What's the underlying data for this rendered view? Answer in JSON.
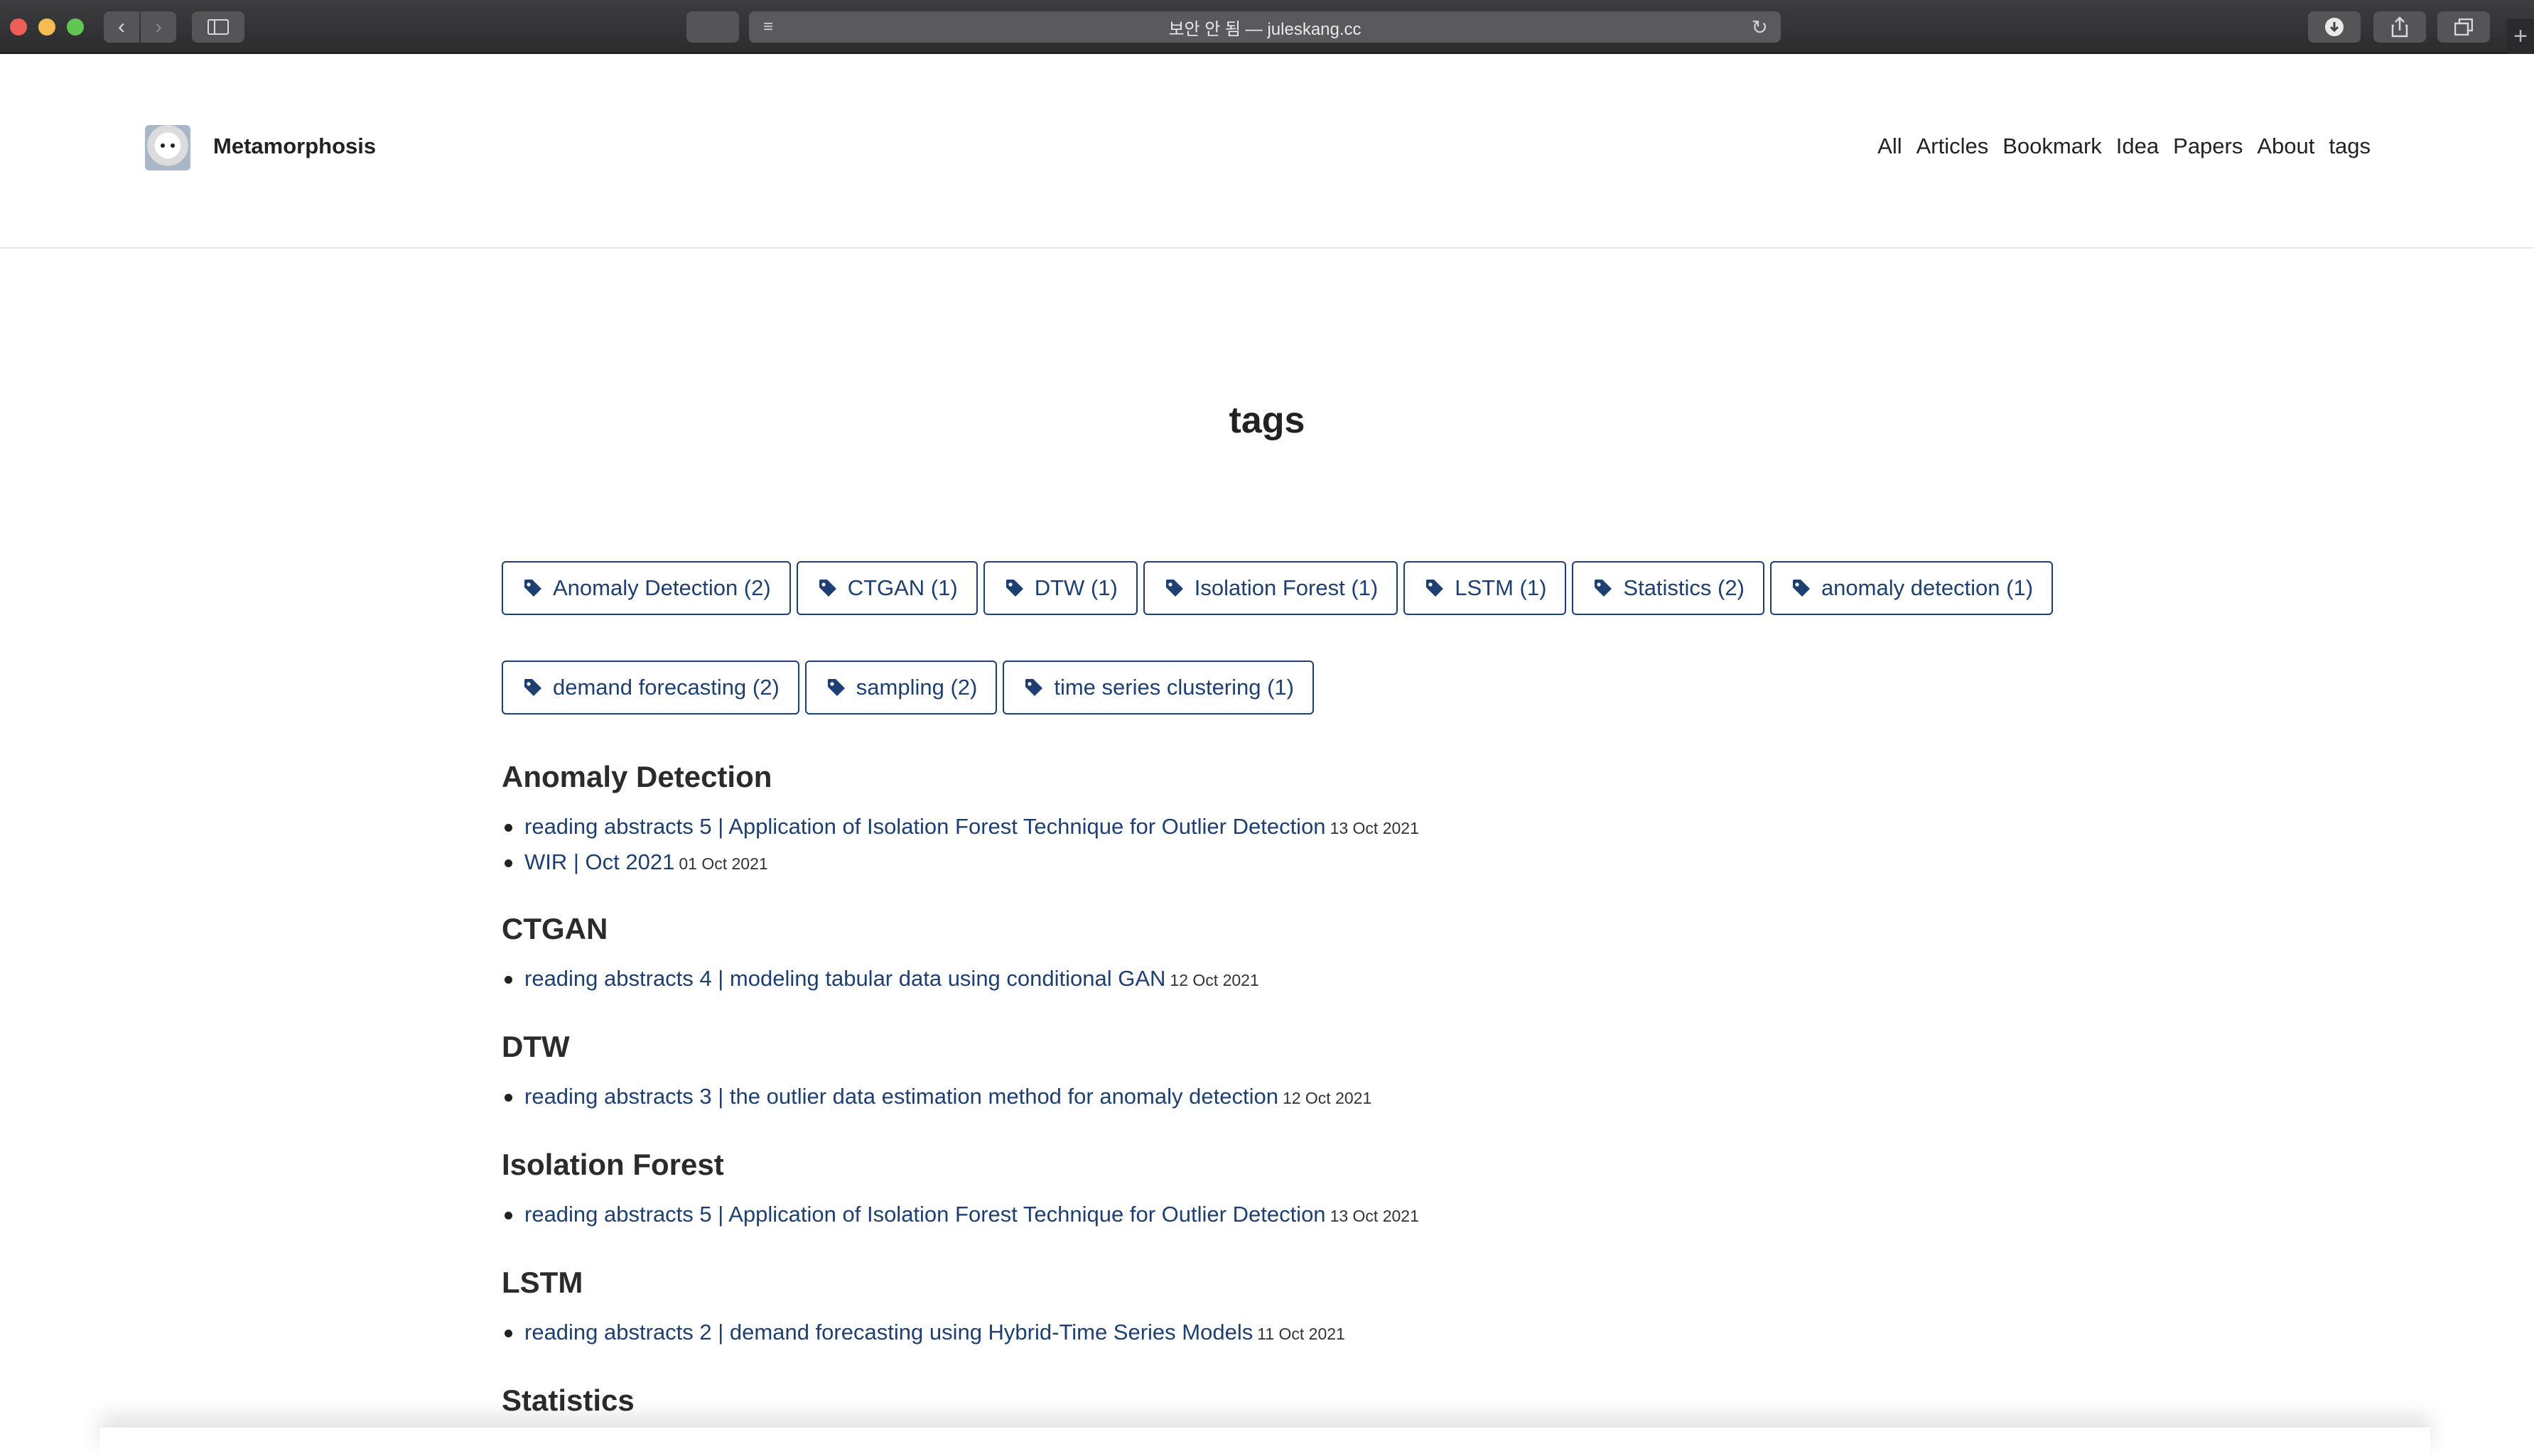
{
  "browser": {
    "address": "보안 안 됨 — juleskang.cc"
  },
  "site": {
    "title": "Metamorphosis",
    "nav": [
      "All",
      "Articles",
      "Bookmark",
      "Idea",
      "Papers",
      "About",
      "tags"
    ]
  },
  "page": {
    "title": "tags",
    "tags_row1": [
      "Anomaly Detection (2)",
      "CTGAN (1)",
      "DTW (1)",
      "Isolation Forest (1)",
      "LSTM (1)",
      "Statistics (2)",
      "anomaly detection (1)"
    ],
    "tags_row2": [
      "demand forecasting (2)",
      "sampling (2)",
      "time series clustering (1)"
    ],
    "sections": [
      {
        "heading": "Anomaly Detection",
        "posts": [
          {
            "title": "reading abstracts 5 | Application of Isolation Forest Technique for Outlier Detection",
            "date": "13 Oct 2021"
          },
          {
            "title": "WIR | Oct 2021",
            "date": "01 Oct 2021"
          }
        ]
      },
      {
        "heading": "CTGAN",
        "posts": [
          {
            "title": "reading abstracts 4 | modeling tabular data using conditional GAN",
            "date": "12 Oct 2021"
          }
        ]
      },
      {
        "heading": "DTW",
        "posts": [
          {
            "title": "reading abstracts 3 | the outlier data estimation method for anomaly detection",
            "date": "12 Oct 2021"
          }
        ]
      },
      {
        "heading": "Isolation Forest",
        "posts": [
          {
            "title": "reading abstracts 5 | Application of Isolation Forest Technique for Outlier Detection",
            "date": "13 Oct 2021"
          }
        ]
      },
      {
        "heading": "LSTM",
        "posts": [
          {
            "title": "reading abstracts 2 | demand forecasting using Hybrid-Time Series Models",
            "date": "11 Oct 2021"
          }
        ]
      },
      {
        "heading": "Statistics",
        "posts": []
      }
    ]
  }
}
